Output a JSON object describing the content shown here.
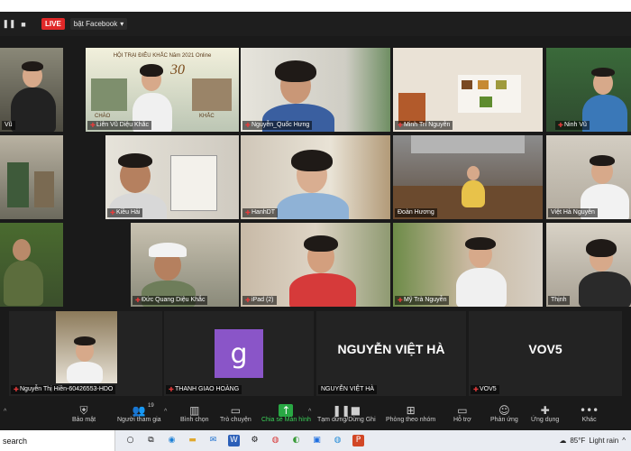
{
  "top_bar": {
    "live_label": "LIVE",
    "stream_target": "bật Facebook"
  },
  "participants": [
    {
      "name": "Vũ",
      "muted": false
    },
    {
      "name": "Liên Vũ Diệu Khắc",
      "muted": true
    },
    {
      "name": "Nguyễn_Quốc Hưng",
      "muted": true
    },
    {
      "name": "Minh Trí Nguyễn",
      "muted": true
    },
    {
      "name": "Ninh Vũ",
      "muted": true
    },
    {
      "name": "",
      "muted": false
    },
    {
      "name": "Kiều Hải",
      "muted": true
    },
    {
      "name": "HanhDT",
      "muted": true
    },
    {
      "name": "Đoàn Hương",
      "muted": false
    },
    {
      "name": "Việt Hà Nguyễn",
      "muted": false
    },
    {
      "name": "",
      "muted": false
    },
    {
      "name": "Đức Quang Diệu Khắc",
      "muted": true
    },
    {
      "name": "iPad (2)",
      "muted": true
    },
    {
      "name": "Mỹ Trà Nguyễn",
      "muted": true
    },
    {
      "name": "Thịnh",
      "muted": false
    },
    {
      "name": "Nguyễn Thị Hiền-60426553-HDO",
      "muted": true
    },
    {
      "name": "THANH GIAO HOÀNG",
      "muted": true
    },
    {
      "name": "NGUYỄN VIỆT HÀ",
      "muted": false
    },
    {
      "name": "VOV5",
      "muted": true
    }
  ],
  "banner": {
    "line1": "HỘI TRẠI ĐIÊU KHẮC Năm 2021 Online",
    "number": "30",
    "line3": "CHÀO",
    "line4": "KHẮC"
  },
  "video_off": {
    "thanh_giao_avatar_letter": "g",
    "nguyen_viet_ha_display": "NGUYỄN VIỆT HÀ",
    "vov5_display": "VOV5"
  },
  "toolbar": {
    "security": "Bảo mật",
    "participants": "Người tham gia",
    "participant_count": "19",
    "polls": "Bình chọn",
    "chat": "Trò chuyện",
    "share_screen": "Chia sẻ Màn hình",
    "pause_stop": "Tạm dừng/Dừng Ghi",
    "breakout": "Phòng theo nhóm",
    "help": "Hỗ trợ",
    "reactions": "Phản ứng",
    "apps": "Ứng dụng",
    "more": "Khác"
  },
  "taskbar": {
    "search": "search",
    "temperature": "85°F",
    "weather": "Light rain"
  },
  "colors": {
    "accent_green": "#29a844",
    "live_red": "#e02828",
    "highlight_yellow": "#e6e24a",
    "avatar_purple": "#8a55c8"
  }
}
